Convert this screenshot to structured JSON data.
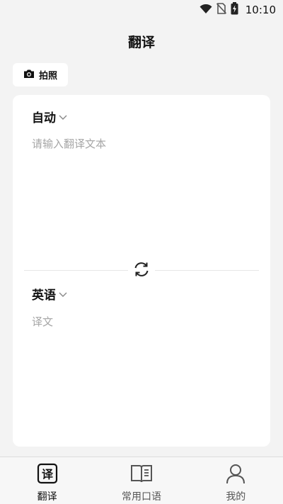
{
  "status_bar": {
    "time": "10:10",
    "icons": [
      "wifi-icon",
      "no-sim-icon",
      "battery-charging-icon"
    ]
  },
  "header": {
    "title": "翻译"
  },
  "photo_button": {
    "label": "拍照",
    "icon": "camera-icon"
  },
  "translator": {
    "source_lang": "自动",
    "input_placeholder": "请输入翻译文本",
    "input_value": "",
    "target_lang": "英语",
    "output_placeholder": "译文",
    "swap_icon": "swap-refresh-icon"
  },
  "tabbar": {
    "active": 0,
    "tabs": [
      {
        "label": "翻译",
        "icon": "translate-icon"
      },
      {
        "label": "常用口语",
        "icon": "book-icon"
      },
      {
        "label": "我的",
        "icon": "person-icon"
      }
    ]
  }
}
